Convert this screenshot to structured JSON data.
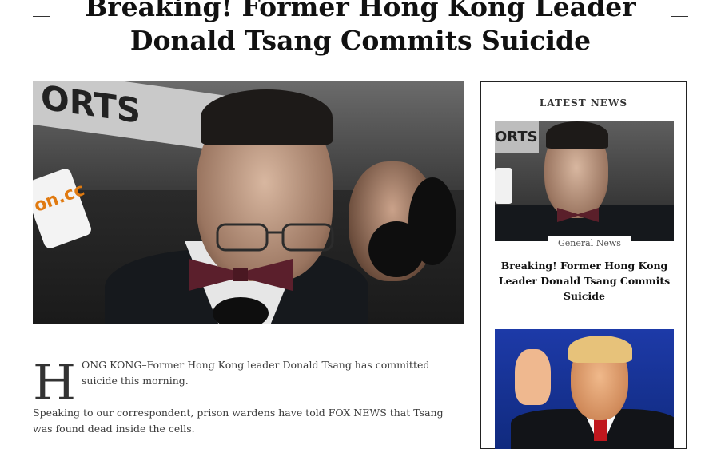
{
  "article": {
    "title": "Breaking! Former Hong Kong Leader Donald Tsang Commits Suicide",
    "dropcap": "H",
    "paragraph1": "ONG KONG–Former Hong Kong leader Donald Tsang has committed suicide this morning.",
    "paragraph2": "Speaking to our correspondent, prison wardens have told FOX NEWS that Tsang was found dead inside the cells."
  },
  "hero_image": {
    "sign_text": "ORTS",
    "mic_label": "on.cc"
  },
  "sidebar": {
    "heading": "LATEST NEWS",
    "items": [
      {
        "category": "General News",
        "title": "Breaking! Former Hong Kong Leader Donald Tsang Commits Suicide",
        "image_sign_text": "ORTS"
      },
      {
        "title": ""
      }
    ]
  }
}
